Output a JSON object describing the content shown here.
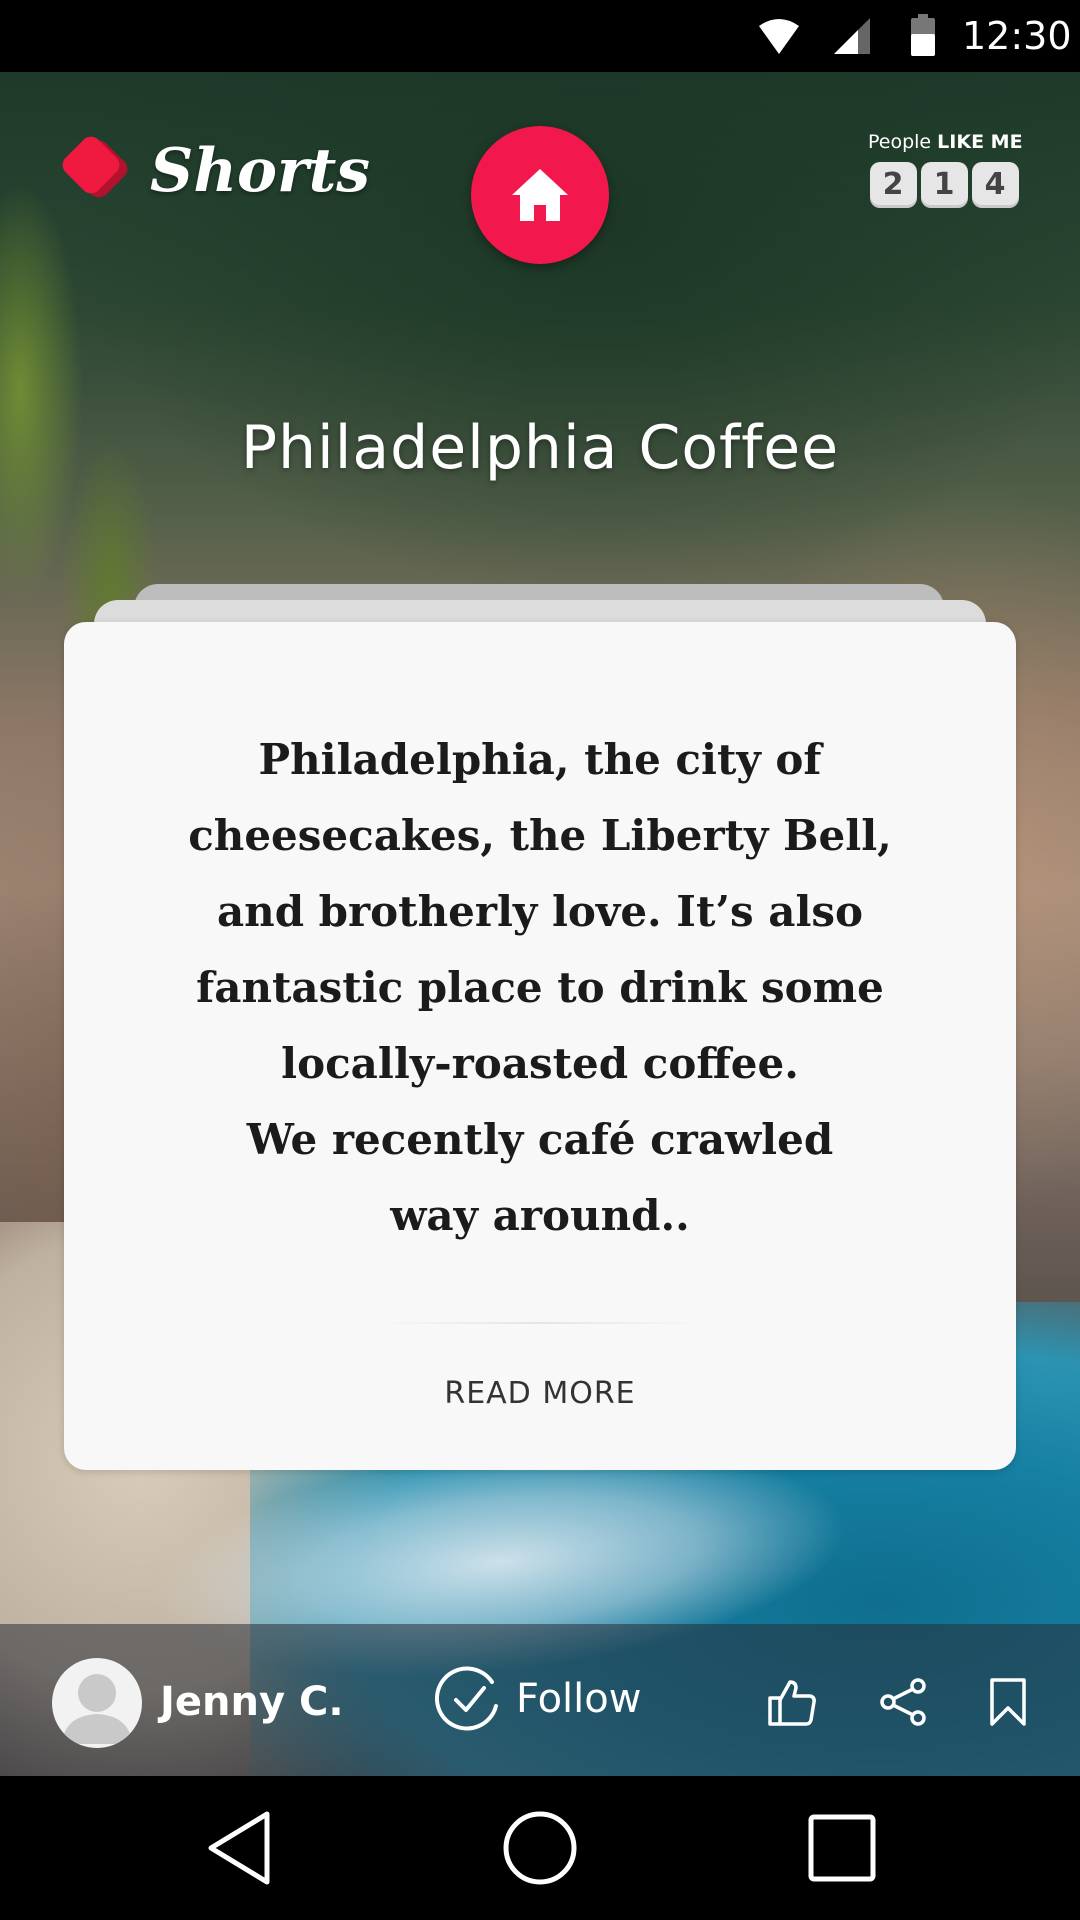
{
  "status_bar": {
    "time": "12:30",
    "icons": [
      "wifi-icon",
      "cell-signal-icon",
      "battery-icon"
    ]
  },
  "header": {
    "app_name": "Shorts",
    "home_icon": "home-icon",
    "people_like_me": {
      "label_prefix": "People",
      "label_bold": "LIKE ME",
      "digits": [
        "2",
        "1",
        "4"
      ]
    }
  },
  "feed": {
    "title": "Philadelphia Coffee"
  },
  "card": {
    "lines": [
      "Philadelphia, the city of",
      "cheesecakes, the Liberty Bell,",
      "and brotherly love. It’s also",
      "fantastic place to drink some",
      "locally-roasted coffee.",
      "We recently café crawled",
      "way around.."
    ],
    "read_more": "READ MORE"
  },
  "action_bar": {
    "author_name": "Jenny C.",
    "follow_label": "Follow",
    "icons": [
      "like-icon",
      "share-icon",
      "bookmark-icon"
    ]
  },
  "nav_bar": {
    "icons": [
      "back-icon",
      "home-circle-icon",
      "recents-icon"
    ]
  },
  "colors": {
    "accent": "#f2174c",
    "logo_dark": "#b3122e"
  }
}
